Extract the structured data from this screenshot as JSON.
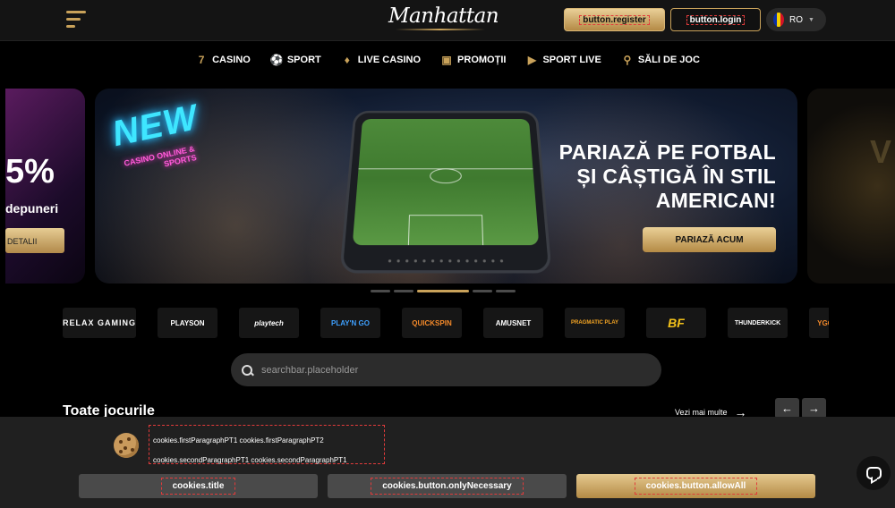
{
  "header": {
    "logo_text": "Manhattan",
    "register_label": "button.register",
    "login_label": "button.login",
    "language": "RO"
  },
  "nav": {
    "items": [
      {
        "label": "CASINO",
        "icon": "seven-icon"
      },
      {
        "label": "SPORT",
        "icon": "soccer-ball-icon"
      },
      {
        "label": "LIVE CASINO",
        "icon": "card-icon"
      },
      {
        "label": "PROMOȚII",
        "icon": "ticket-icon"
      },
      {
        "label": "SPORT LIVE",
        "icon": "tv-icon"
      },
      {
        "label": "SĂLI DE JOC",
        "icon": "location-pin-icon"
      }
    ]
  },
  "banner_left": {
    "percent": "5%",
    "text": "depuneri",
    "button": "DETALII"
  },
  "banner_main": {
    "neon_title": "NEW",
    "neon_sub": "CASINO ONLINE & SPORTS",
    "headline_1": "PARIAZĂ PE FOTBAL",
    "headline_2": "ȘI CÂȘTIGĂ ÎN STIL",
    "headline_3": "AMERICAN!",
    "cta": "PARIAZĂ ACUM"
  },
  "carousel": {
    "active_index": 2,
    "count": 6
  },
  "providers": [
    "RELAX GAMING",
    "PLAYSON",
    "playtech",
    "PLAY'N GO",
    "QUICKSPIN",
    "AMUSNET",
    "PRAGMATIC PLAY",
    "BF",
    "THUNDERKICK",
    "YGG"
  ],
  "search": {
    "placeholder": "searchbar.placeholder"
  },
  "games": {
    "title": "Toate jocurile",
    "see_more": "Vezi mai multe"
  },
  "cookies": {
    "line_1": "cookies.firstParagraphPT1 cookies.firstParagraphPT2",
    "line_2": "cookies.secondParagraphPT1 cookies.secondParagraphPT1",
    "title_button": "cookies.title",
    "necessary_button": "cookies.button.onlyNecessary",
    "allow_button": "cookies.button.allowAll"
  },
  "colors": {
    "accent_gold": "#c9a25a",
    "background": "#000000"
  }
}
